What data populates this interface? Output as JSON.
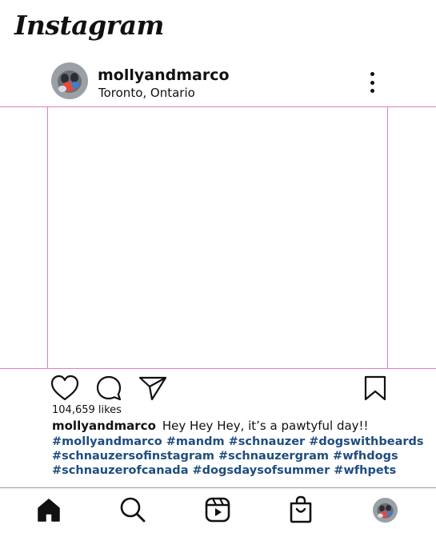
{
  "app": {
    "logo": "Instagram"
  },
  "post": {
    "username": "mollyandmarco",
    "location": "Toronto, Ontario",
    "likes": "104,659 likes",
    "caption_user": "mollyandmarco",
    "caption_text": "Hey Hey Hey, it’s a pawtyful day!!",
    "hashtag_lines": [
      "#mollyandmarco #mandm #schnauzer #dogswithbeards",
      "#schnauzersofinstagram #schnauzergram #wfhdogs",
      "#schnauzerofcanada #dogsdaysofsummer #wfhpets"
    ]
  },
  "icons": {
    "more": "more-options-icon",
    "like": "heart-icon",
    "comment": "comment-icon",
    "share": "send-icon",
    "save": "bookmark-icon",
    "nav": [
      "home-icon",
      "search-icon",
      "reels-icon",
      "shop-icon",
      "profile-avatar"
    ]
  },
  "colors": {
    "hashtag": "#1f4d80",
    "image_border": "#e080b8"
  }
}
